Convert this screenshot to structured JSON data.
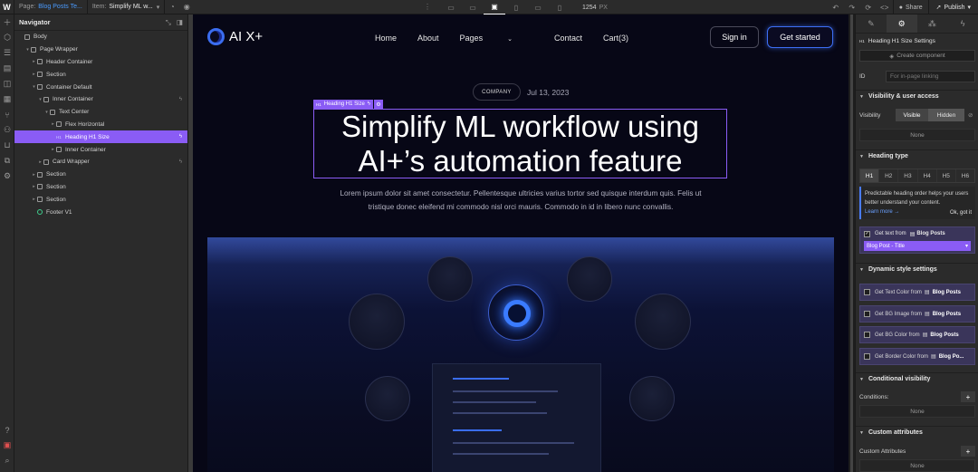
{
  "topbar": {
    "logo": "W",
    "page_label": "Page:",
    "page_value": "Blog Posts Te...",
    "item_label": "Item:",
    "item_value": "Simplify ML w...",
    "width_value": "1254",
    "width_unit": "PX",
    "share_label": "Share",
    "publish_label": "Publish"
  },
  "navigator": {
    "title": "Navigator",
    "tree": [
      {
        "label": "Body",
        "depth": 0,
        "caret": "",
        "kind": "box"
      },
      {
        "label": "Page Wrapper",
        "depth": 1,
        "caret": "▾",
        "kind": "box"
      },
      {
        "label": "Header Container",
        "depth": 2,
        "caret": "▸",
        "kind": "box"
      },
      {
        "label": "Section",
        "depth": 2,
        "caret": "▸",
        "kind": "box"
      },
      {
        "label": "Container Default",
        "depth": 2,
        "caret": "▾",
        "kind": "box"
      },
      {
        "label": "Inner Container",
        "depth": 3,
        "caret": "▾",
        "kind": "box",
        "bolt": true
      },
      {
        "label": "Text Center",
        "depth": 4,
        "caret": "▾",
        "kind": "box"
      },
      {
        "label": "Flex Horizontal",
        "depth": 5,
        "caret": "▸",
        "kind": "box"
      },
      {
        "label": "Heading H1 Size",
        "depth": 5,
        "caret": "",
        "kind": "h1",
        "bolt": true,
        "selected": true
      },
      {
        "label": "Inner Container",
        "depth": 5,
        "caret": "▸",
        "kind": "box"
      },
      {
        "label": "Card Wrapper",
        "depth": 3,
        "caret": "▸",
        "kind": "box",
        "bolt": true
      },
      {
        "label": "Section",
        "depth": 2,
        "caret": "▸",
        "kind": "box"
      },
      {
        "label": "Section",
        "depth": 2,
        "caret": "▸",
        "kind": "box"
      },
      {
        "label": "Section",
        "depth": 2,
        "caret": "▸",
        "kind": "box"
      },
      {
        "label": "Footer V1",
        "depth": 2,
        "caret": "",
        "kind": "comp"
      }
    ]
  },
  "site": {
    "logo_text": "AI X+",
    "nav": [
      "Home",
      "About",
      "Pages",
      "Contact",
      "Cart(3)"
    ],
    "signin": "Sign in",
    "get_started": "Get started",
    "badge": "COMPANY",
    "date": "Jul 13, 2023",
    "selection_tag": "Heading H1 Size",
    "heading": "Simplify ML workflow using AI+’s automation feature",
    "subtext": "Lorem ipsum dolor sit amet consectetur. Pellentesque ultricies varius tortor sed quisque interdum quis. Felis ut tristique donec eleifend mi commodo nisl orci mauris. Commodo in id in libero nunc convallis."
  },
  "settings": {
    "title": "Heading H1 Size Settings",
    "create_component": "Create component",
    "id_label": "ID",
    "id_placeholder": "For in-page linking",
    "visibility_section": "Visibility & user access",
    "visibility_label": "Visibility",
    "visible": "Visible",
    "hidden": "Hidden",
    "none": "None",
    "heading_type_section": "Heading type",
    "heading_types": [
      "H1",
      "H2",
      "H3",
      "H4",
      "H5",
      "H6"
    ],
    "info_text": "Predictable heading order helps your users better understand your content.",
    "learn_more": "Learn more →",
    "ok_got_it": "Ok, got it",
    "get_text_from": "Get text from",
    "blog_posts": "Blog Posts",
    "bound_field": "Blog Post - Title",
    "dynamic_section": "Dynamic style settings",
    "dynamic_items": [
      {
        "label": "Get Text Color from",
        "source": "Blog Posts"
      },
      {
        "label": "Get BG Image from",
        "source": "Blog Posts"
      },
      {
        "label": "Get BG Color from",
        "source": "Blog Posts"
      },
      {
        "label": "Get Border Color from",
        "source": "Blog Po..."
      }
    ],
    "conditional_section": "Conditional visibility",
    "conditions_label": "Conditions:",
    "custom_attr_section": "Custom attributes",
    "custom_attr_label": "Custom Attributes"
  },
  "colors": {
    "accent_purple": "#8a5cf5",
    "brand_blue": "#3b6df0",
    "link_blue": "#4a9bff"
  }
}
